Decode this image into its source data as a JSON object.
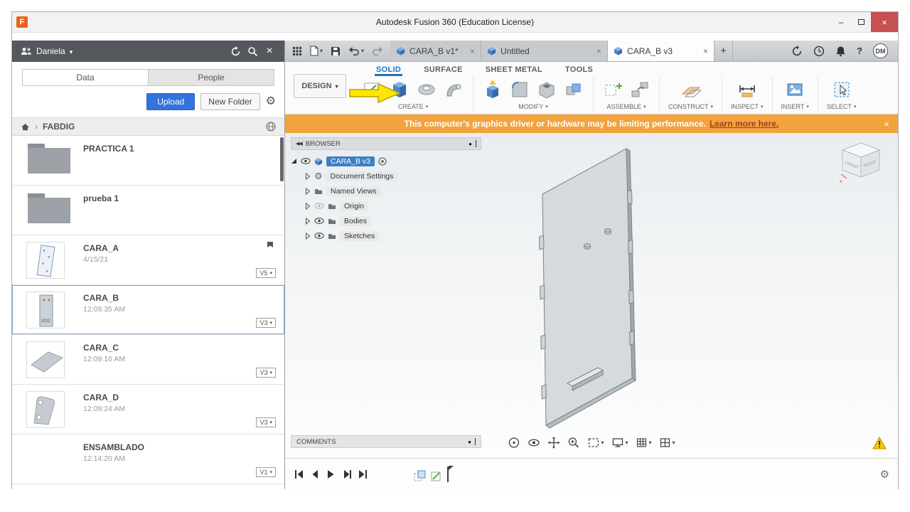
{
  "window": {
    "title": "Autodesk Fusion 360 (Education License)",
    "app_letter": "F"
  },
  "data_panel": {
    "user": "Daniela",
    "tabs": [
      {
        "label": "Data"
      },
      {
        "label": "People"
      }
    ],
    "actions": {
      "upload": "Upload",
      "new_folder": "New Folder"
    },
    "breadcrumb": {
      "root": "FABDIG",
      "separator": "›"
    },
    "items": [
      {
        "name": "PRACTICA 1",
        "meta": "",
        "version": ""
      },
      {
        "name": "prueba 1",
        "meta": "",
        "version": ""
      },
      {
        "name": "CARA_A",
        "meta": "4/15/21",
        "version": "V5"
      },
      {
        "name": "CARA_B",
        "meta": "12:09:35 AM",
        "version": "V3"
      },
      {
        "name": "CARA_C",
        "meta": "12:09:16 AM",
        "version": "V3"
      },
      {
        "name": "CARA_D",
        "meta": "12:09:24 AM",
        "version": "V3"
      },
      {
        "name": "ENSAMBLADO",
        "meta": "12:14:20 AM",
        "version": "V1"
      }
    ]
  },
  "app_bar": {
    "document_tabs": [
      {
        "label": "CARA_B v1*"
      },
      {
        "label": "Untitled"
      },
      {
        "label": "CARA_B v3"
      }
    ],
    "new_tab": "+",
    "avatar": "DM",
    "help": "?"
  },
  "ribbon": {
    "workspace": "DESIGN",
    "tabs": [
      {
        "label": "SOLID"
      },
      {
        "label": "SURFACE"
      },
      {
        "label": "SHEET METAL"
      },
      {
        "label": "TOOLS"
      }
    ],
    "groups": [
      {
        "label": "CREATE"
      },
      {
        "label": "MODIFY"
      },
      {
        "label": "ASSEMBLE"
      },
      {
        "label": "CONSTRUCT"
      },
      {
        "label": "INSPECT"
      },
      {
        "label": "INSERT"
      },
      {
        "label": "SELECT"
      }
    ]
  },
  "banner": {
    "text": "This computer's graphics driver or hardware may be limiting performance.",
    "link": "Learn more here.",
    "close": "×"
  },
  "browser": {
    "title": "BROWSER",
    "collapse": "◀◀",
    "root": "CARA_B v3",
    "nodes": [
      {
        "label": "Document Settings"
      },
      {
        "label": "Named Views"
      },
      {
        "label": "Origin"
      },
      {
        "label": "Bodies"
      },
      {
        "label": "Sketches"
      }
    ]
  },
  "comments": {
    "title": "COMMENTS"
  },
  "viewcube": {
    "front": "FRONT",
    "right": "RIGHT",
    "axis_x": "x"
  },
  "icons": {
    "caret": "▾",
    "gear": "⚙",
    "dot": "●",
    "close": "×",
    "plus": "+",
    "minimize": "–"
  },
  "colors": {
    "accent_blue": "#3273DC",
    "ribbon_active_blue": "#1F74BD",
    "banner_orange": "#F2A33C",
    "selection_blue": "#3E80C6",
    "annotation_arrow_yellow": "#FFE600",
    "warning_yellow": "#F5C400",
    "panel_header_gray": "#54575C"
  }
}
